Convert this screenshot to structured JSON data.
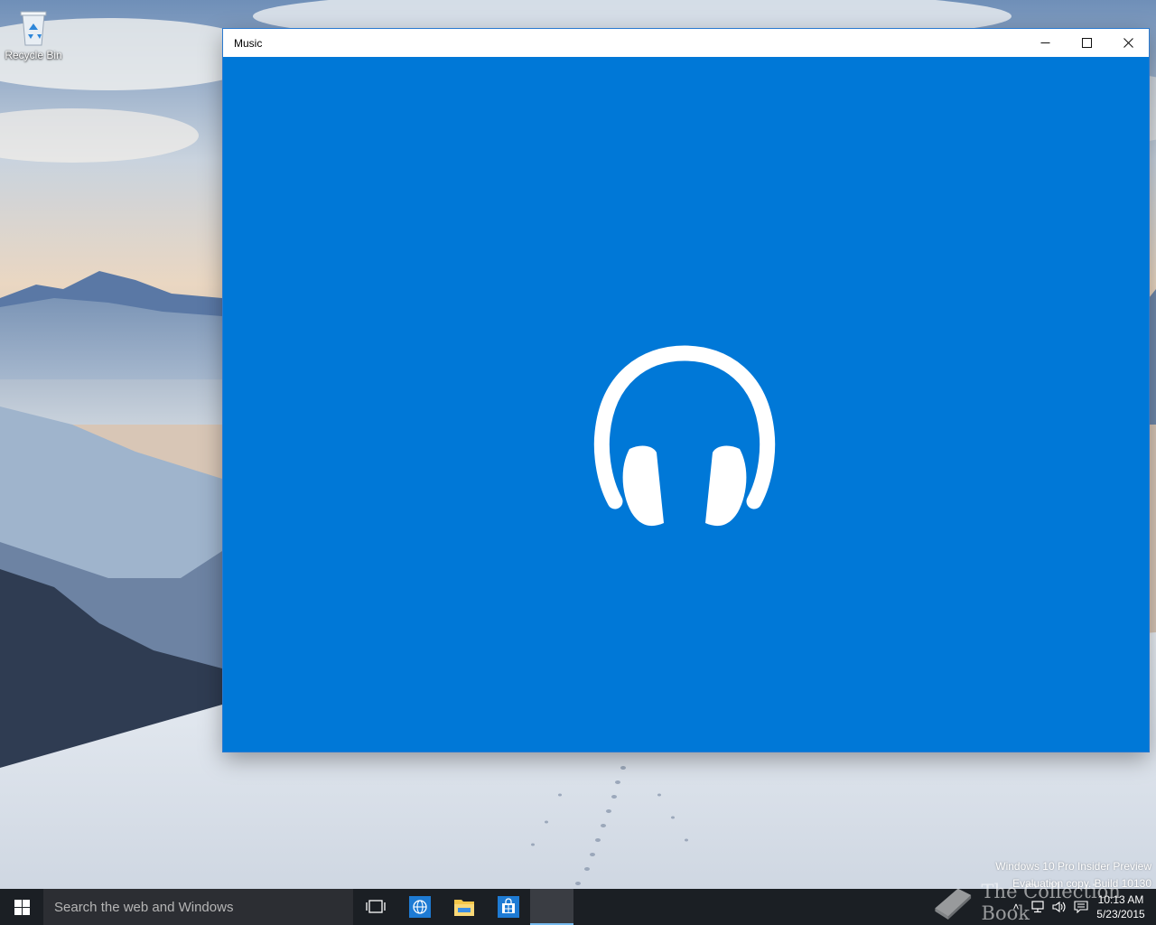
{
  "desktop": {
    "icons": [
      {
        "label": "Recycle Bin",
        "icon": "recycle-bin-icon"
      }
    ],
    "watermark": {
      "line1": "Windows 10 Pro Insider Preview",
      "line2": "Evaluation copy. Build 10130"
    }
  },
  "window": {
    "title": "Music",
    "controls": {
      "minimize": "minimize-icon",
      "maximize": "maximize-icon",
      "close": "close-icon"
    },
    "splash_icon": "headphones-icon",
    "accent_color": "#0078d7"
  },
  "taskbar": {
    "search_placeholder": "Search the web and Windows",
    "pinned": [
      {
        "name": "task-view",
        "icon": "task-view-icon"
      },
      {
        "name": "internet-explorer",
        "icon": "globe-icon"
      },
      {
        "name": "file-explorer",
        "icon": "folder-icon"
      },
      {
        "name": "store",
        "icon": "store-icon"
      }
    ],
    "clock": {
      "time": "10:13 AM",
      "date": "5/23/2015"
    },
    "overlay_brand": "The Collection Book"
  }
}
